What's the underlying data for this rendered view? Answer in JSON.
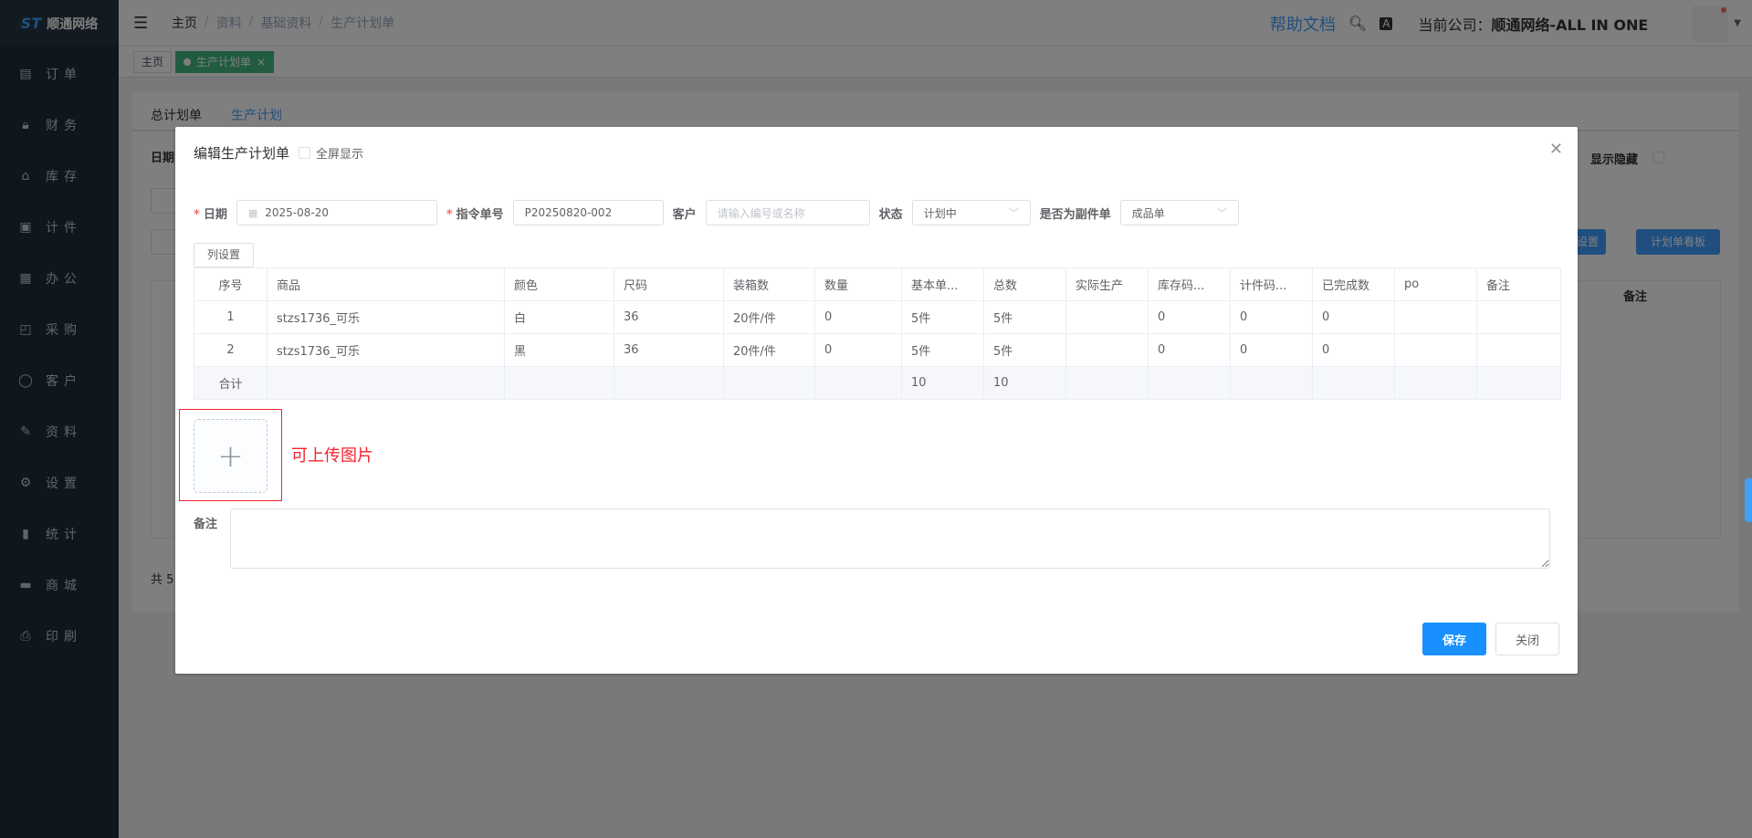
{
  "app": {
    "logo_text": "顺通网络"
  },
  "sidebar": {
    "items": [
      {
        "label": "订单",
        "icon": "order-icon"
      },
      {
        "label": "财务",
        "icon": "lock-icon"
      },
      {
        "label": "库存",
        "icon": "home-icon"
      },
      {
        "label": "计件",
        "icon": "clipboard-icon"
      },
      {
        "label": "办公",
        "icon": "calendar-icon"
      },
      {
        "label": "采购",
        "icon": "bag-icon"
      },
      {
        "label": "客户",
        "icon": "user-icon"
      },
      {
        "label": "资料",
        "icon": "edit-icon"
      },
      {
        "label": "设置",
        "icon": "gear-icon"
      },
      {
        "label": "统计",
        "icon": "bar-chart-icon"
      },
      {
        "label": "商城",
        "icon": "shop-icon"
      },
      {
        "label": "印刷",
        "icon": "printer-icon"
      }
    ]
  },
  "header": {
    "breadcrumb": [
      "主页",
      "资料",
      "基础资料",
      "生产计划单"
    ],
    "help": "帮助文档",
    "company_prefix": "当前公司：",
    "company_name": "顺通网络-ALL IN ONE"
  },
  "tags": {
    "home": "主页",
    "active": "生产计划单",
    "active_close": "×"
  },
  "background": {
    "tabs": [
      "总计划单",
      "生产计划"
    ],
    "date_label": "日期",
    "show_hidden": "显示隐藏",
    "btn_status_settings": "态设置",
    "btn_board": "计划单看板",
    "col_remark": "备注",
    "total_prefix": "共 5"
  },
  "dialog": {
    "title": "编辑生产计划单",
    "fullscreen_label": "全屏显示",
    "form": {
      "date_label": "日期",
      "date_value": "2025-08-20",
      "order_no_label": "指令单号",
      "order_no_value": "P20250820-002",
      "customer_label": "客户",
      "customer_placeholder": "请输入编号或名称",
      "status_label": "状态",
      "status_value": "计划中",
      "copy_label": "是否为副件单",
      "copy_value": "成品单"
    },
    "column_settings": "列设置",
    "table": {
      "headers": [
        "序号",
        "商品",
        "颜色",
        "尺码",
        "装箱数",
        "数量",
        "基本单...",
        "总数",
        "实际生产",
        "库存码...",
        "计件码...",
        "已完成数",
        "po",
        "备注"
      ],
      "rows": [
        [
          "1",
          "stzs1736_可乐",
          "白",
          "36",
          "20件/件",
          "0",
          "5件",
          "5件",
          "",
          "0",
          "0",
          "0",
          "",
          ""
        ],
        [
          "2",
          "stzs1736_可乐",
          "黑",
          "36",
          "20件/件",
          "0",
          "5件",
          "5件",
          "",
          "0",
          "0",
          "0",
          "",
          ""
        ]
      ],
      "summary": [
        "合计",
        "",
        "",
        "",
        "",
        "",
        "10",
        "10",
        "",
        "",
        "",
        "",
        "",
        ""
      ]
    },
    "upload_hint": "可上传图片",
    "remark_label": "备注",
    "save": "保存",
    "close": "关闭"
  },
  "colors": {
    "primary": "#1890ff",
    "accent_green": "#42b983",
    "hint_red": "#f5222d",
    "sidebar_bg": "#1f2d3d"
  }
}
